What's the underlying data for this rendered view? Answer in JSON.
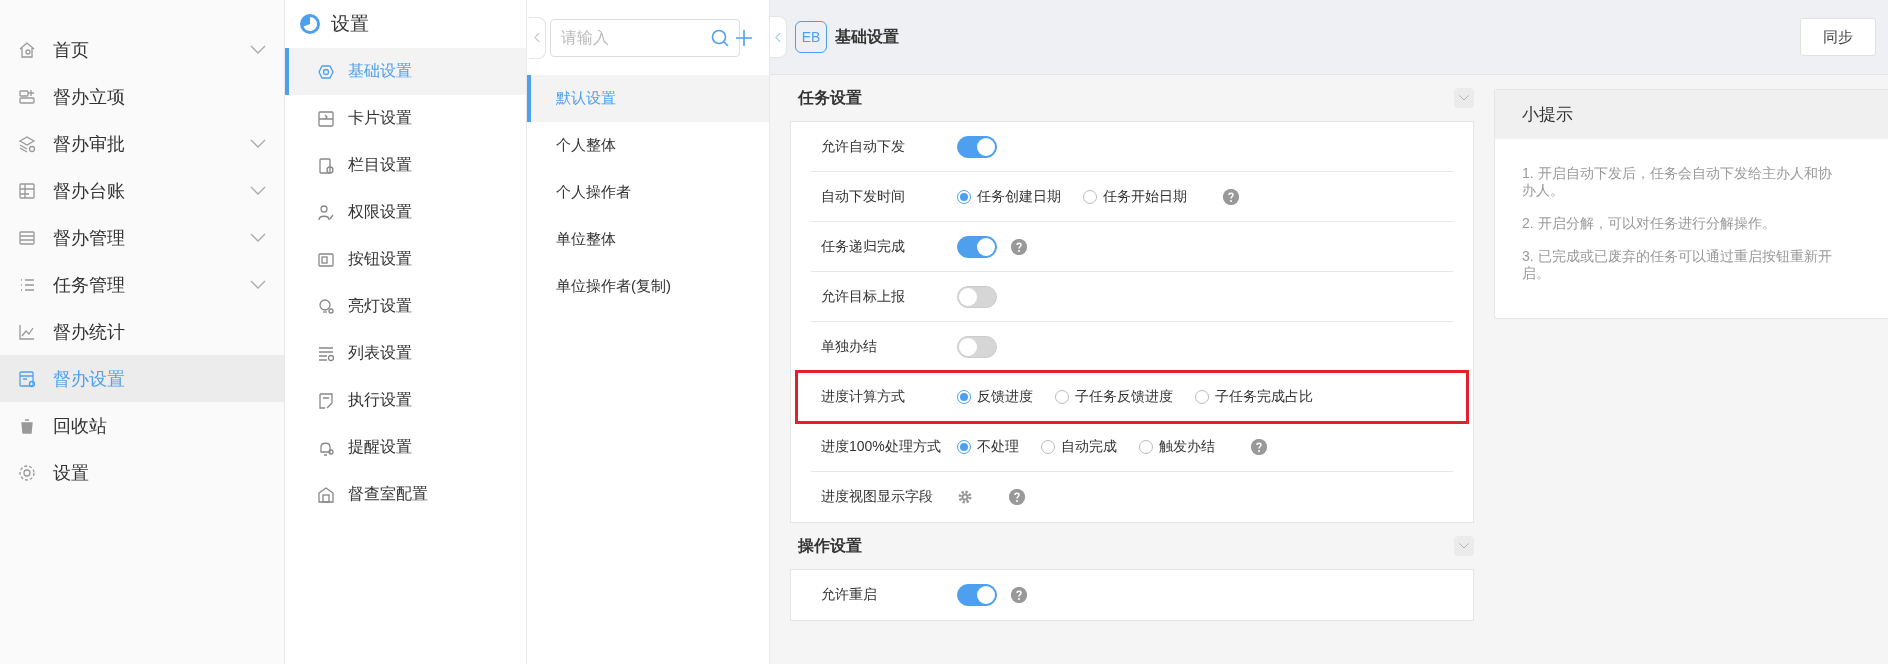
{
  "nav": {
    "items": [
      {
        "label": "首页",
        "expandable": true,
        "selected": false
      },
      {
        "label": "督办立项",
        "expandable": false,
        "selected": false
      },
      {
        "label": "督办审批",
        "expandable": true,
        "selected": false
      },
      {
        "label": "督办台账",
        "expandable": true,
        "selected": false
      },
      {
        "label": "督办管理",
        "expandable": true,
        "selected": false
      },
      {
        "label": "任务管理",
        "expandable": true,
        "selected": false
      },
      {
        "label": "督办统计",
        "expandable": false,
        "selected": false
      },
      {
        "label": "督办设置",
        "expandable": false,
        "selected": true
      },
      {
        "label": "回收站",
        "expandable": false,
        "selected": false
      },
      {
        "label": "设置",
        "expandable": false,
        "selected": false
      }
    ]
  },
  "settings_menu": {
    "title": "设置",
    "items": [
      {
        "label": "基础设置",
        "selected": true
      },
      {
        "label": "卡片设置",
        "selected": false
      },
      {
        "label": "栏目设置",
        "selected": false
      },
      {
        "label": "权限设置",
        "selected": false
      },
      {
        "label": "按钮设置",
        "selected": false
      },
      {
        "label": "亮灯设置",
        "selected": false
      },
      {
        "label": "列表设置",
        "selected": false
      },
      {
        "label": "执行设置",
        "selected": false
      },
      {
        "label": "提醒设置",
        "selected": false
      },
      {
        "label": "督查室配置",
        "selected": false
      }
    ]
  },
  "schemes": {
    "search": {
      "placeholder": "请输入"
    },
    "items": [
      {
        "label": "默认设置",
        "selected": true
      },
      {
        "label": "个人整体",
        "selected": false
      },
      {
        "label": "个人操作者",
        "selected": false
      },
      {
        "label": "单位整体",
        "selected": false
      },
      {
        "label": "单位操作者(复制)",
        "selected": false
      }
    ]
  },
  "header": {
    "badge": "EB",
    "title": "基础设置",
    "sync_button": "同步"
  },
  "sections": [
    {
      "title": "任务设置",
      "rows": [
        {
          "kind": "toggle",
          "label": "允许自动下发",
          "on": true,
          "help": false,
          "highlighted": false
        },
        {
          "kind": "radio",
          "label": "自动下发时间",
          "options": [
            {
              "label": "任务创建日期",
              "selected": true
            },
            {
              "label": "任务开始日期",
              "selected": false
            }
          ],
          "help": true,
          "highlighted": false
        },
        {
          "kind": "toggle",
          "label": "任务递归完成",
          "on": true,
          "help": true,
          "highlighted": false
        },
        {
          "kind": "toggle",
          "label": "允许目标上报",
          "on": false,
          "help": false,
          "highlighted": false
        },
        {
          "kind": "toggle",
          "label": "单独办结",
          "on": false,
          "help": false,
          "highlighted": false
        },
        {
          "kind": "radio",
          "label": "进度计算方式",
          "options": [
            {
              "label": "反馈进度",
              "selected": true
            },
            {
              "label": "子任务反馈进度",
              "selected": false
            },
            {
              "label": "子任务完成占比",
              "selected": false
            }
          ],
          "help": false,
          "highlighted": true
        },
        {
          "kind": "radio",
          "label": "进度100%处理方式",
          "options": [
            {
              "label": "不处理",
              "selected": true
            },
            {
              "label": "自动完成",
              "selected": false
            },
            {
              "label": "触发办结",
              "selected": false
            }
          ],
          "help": true,
          "highlighted": false
        },
        {
          "kind": "gear",
          "label": "进度视图显示字段",
          "help": true,
          "highlighted": false
        }
      ]
    },
    {
      "title": "操作设置",
      "rows": [
        {
          "kind": "toggle",
          "label": "允许重启",
          "on": true,
          "help": true,
          "highlighted": false
        }
      ]
    }
  ],
  "tips": {
    "title": "小提示",
    "items": [
      "1. 开启自动下发后，任务会自动下发给主办人和协办人。",
      "2. 开启分解，可以对任务进行分解操作。",
      "3. 已完成或已废弃的任务可以通过重启按钮重新开启。"
    ]
  }
}
